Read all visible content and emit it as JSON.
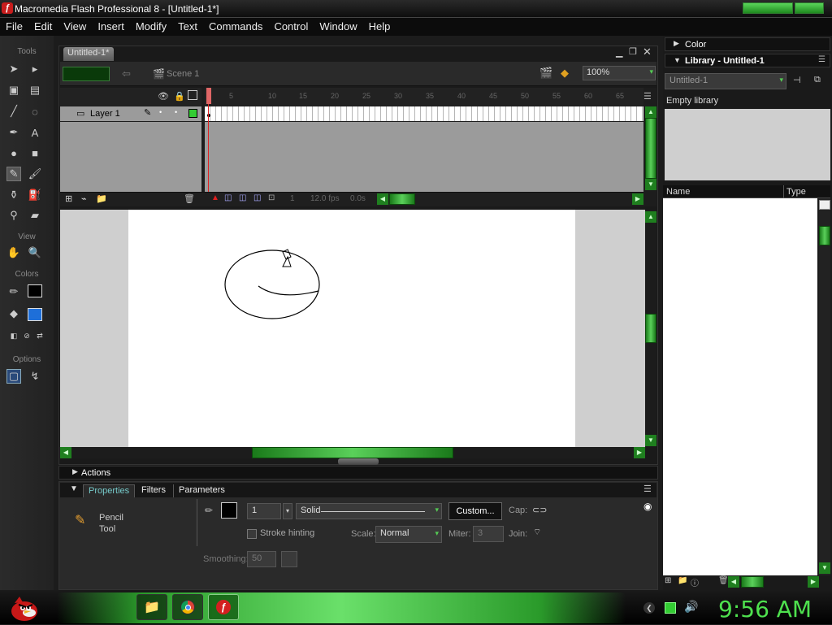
{
  "window": {
    "title": "Macromedia Flash Professional 8 - [Untitled-1*]"
  },
  "menu": [
    "File",
    "Edit",
    "View",
    "Insert",
    "Modify",
    "Text",
    "Commands",
    "Control",
    "Window",
    "Help"
  ],
  "toolbox": {
    "tools_label": "Tools",
    "view_label": "View",
    "colors_label": "Colors",
    "options_label": "Options"
  },
  "document": {
    "tab": "Untitled-1*",
    "scene": "Scene 1",
    "zoom": "100%",
    "layer_name": "Layer 1",
    "ruler_numbers": [
      "5",
      "10",
      "15",
      "20",
      "25",
      "30",
      "35",
      "40",
      "45",
      "50",
      "55",
      "60",
      "65"
    ],
    "status": {
      "frame": "1",
      "fps": "12.0 fps",
      "time": "0.0s"
    }
  },
  "actions_panel": {
    "label": "Actions"
  },
  "properties": {
    "tabs": [
      "Properties",
      "Filters",
      "Parameters"
    ],
    "tool_name": "Pencil",
    "tool_sub": "Tool",
    "stroke_width": "1",
    "stroke_style": "Solid",
    "custom_button": "Custom...",
    "cap_label": "Cap:",
    "stroke_hinting": "Stroke hinting",
    "scale_label": "Scale:",
    "scale_value": "Normal",
    "miter_label": "Miter:",
    "miter_value": "3",
    "join_label": "Join:",
    "smoothing_label": "Smoothing:",
    "smoothing_value": "50"
  },
  "right_panel": {
    "color_label": "Color",
    "library_label": "Library - Untitled-1",
    "library_select": "Untitled-1",
    "empty_text": "Empty library",
    "col_name": "Name",
    "col_type": "Type"
  },
  "taskbar": {
    "clock": "9:56 AM"
  },
  "colors": {
    "accent_green": "#3ec43e",
    "clock": "#4ee04e",
    "playhead": "#e02020"
  }
}
